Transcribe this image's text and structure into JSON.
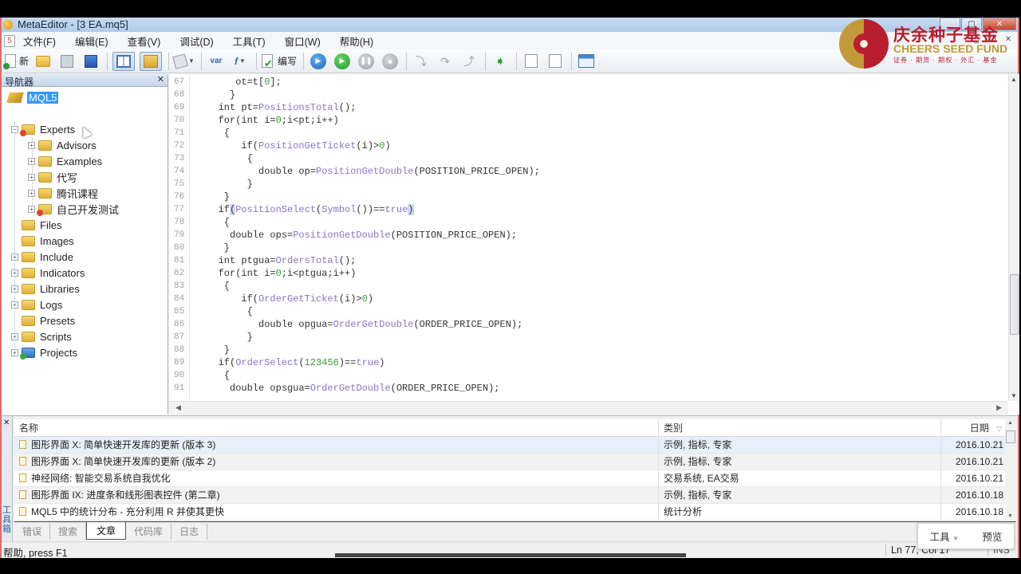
{
  "window": {
    "title": "MetaEditor - [3 EA.mq5]",
    "controls": [
      "minimize",
      "maximize",
      "close"
    ]
  },
  "menu": {
    "items": [
      "文件(F)",
      "编辑(E)",
      "查看(V)",
      "调试(D)",
      "工具(T)",
      "窗口(W)",
      "帮助(H)"
    ]
  },
  "toolbar": {
    "new_label": "新",
    "compile_label": "编写",
    "var_label": "var",
    "func_label": "f"
  },
  "logo": {
    "cn": "庆余种子基金",
    "en": "CHEERS SEED FUND",
    "sub": "证券 · 期货 · 期权 · 外汇 · 基金"
  },
  "navigator": {
    "title": "导航器",
    "root": "MQL5",
    "experts": {
      "label": "Experts",
      "children": [
        "Advisors",
        "Examples",
        "代写",
        "腾讯课程",
        "自己开发测试"
      ]
    },
    "folders": [
      "Files",
      "Images",
      "Include",
      "Indicators",
      "Libraries",
      "Logs",
      "Presets",
      "Scripts",
      "Projects"
    ]
  },
  "editor": {
    "lines": [
      {
        "n": "67",
        "code": "      ot=t[0];"
      },
      {
        "n": "68",
        "code": "     }"
      },
      {
        "n": "69",
        "code": "   int pt=PositionsTotal();"
      },
      {
        "n": "70",
        "code": "   for(int i=0;i<pt;i++)"
      },
      {
        "n": "71",
        "code": "    {"
      },
      {
        "n": "72",
        "code": "       if(PositionGetTicket(i)>0)"
      },
      {
        "n": "73",
        "code": "        {"
      },
      {
        "n": "74",
        "code": "          double op=PositionGetDouble(POSITION_PRICE_OPEN);"
      },
      {
        "n": "75",
        "code": "        }"
      },
      {
        "n": "76",
        "code": "    }"
      },
      {
        "n": "77",
        "code": "   if(PositionSelect(Symbol())==true)"
      },
      {
        "n": "78",
        "code": "    {"
      },
      {
        "n": "79",
        "code": "     double ops=PositionGetDouble(POSITION_PRICE_OPEN);"
      },
      {
        "n": "80",
        "code": "    }"
      },
      {
        "n": "81",
        "code": "   int ptgua=OrdersTotal();"
      },
      {
        "n": "82",
        "code": "   for(int i=0;i<ptgua;i++)"
      },
      {
        "n": "83",
        "code": "    {"
      },
      {
        "n": "84",
        "code": "       if(OrderGetTicket(i)>0)"
      },
      {
        "n": "85",
        "code": "        {"
      },
      {
        "n": "86",
        "code": "          double opgua=OrderGetDouble(ORDER_PRICE_OPEN);"
      },
      {
        "n": "87",
        "code": "        }"
      },
      {
        "n": "88",
        "code": "    }"
      },
      {
        "n": "89",
        "code": "   if(OrderSelect(123456)==true)"
      },
      {
        "n": "90",
        "code": "    {"
      },
      {
        "n": "91",
        "code": "     double opsgua=OrderGetDouble(ORDER_PRICE_OPEN);"
      }
    ]
  },
  "toolbox": {
    "side_title": "工具箱",
    "columns": {
      "name": "名称",
      "category": "类别",
      "date": "日期"
    },
    "rows": [
      {
        "name": "图形界面 X: 简单快速开发库的更新 (版本 3)",
        "category": "示例, 指标, 专家",
        "date": "2016.10.21"
      },
      {
        "name": "图形界面 X: 简单快速开发库的更新 (版本 2)",
        "category": "示例, 指标, 专家",
        "date": "2016.10.21"
      },
      {
        "name": "神经网络: 智能交易系统自我优化",
        "category": "交易系统, EA交易",
        "date": "2016.10.21"
      },
      {
        "name": "图形界面 IX: 进度条和线形图表控件 (第二章)",
        "category": "示例, 指标, 专家",
        "date": "2016.10.18"
      },
      {
        "name": "MQL5 中的统计分布 - 充分利用 R 并使其更快",
        "category": "统计分析",
        "date": "2016.10.18"
      }
    ],
    "tabs": [
      {
        "label": "错误",
        "active": false
      },
      {
        "label": "搜索",
        "active": false
      },
      {
        "label": "文章",
        "active": true
      },
      {
        "label": "代码库",
        "active": false
      },
      {
        "label": "日志",
        "active": false
      }
    ],
    "popup": {
      "tools": "工具",
      "preview": "预览"
    }
  },
  "statusbar": {
    "help": "帮助, press F1",
    "position": "Ln 77, Col 17",
    "mode": "INS"
  }
}
